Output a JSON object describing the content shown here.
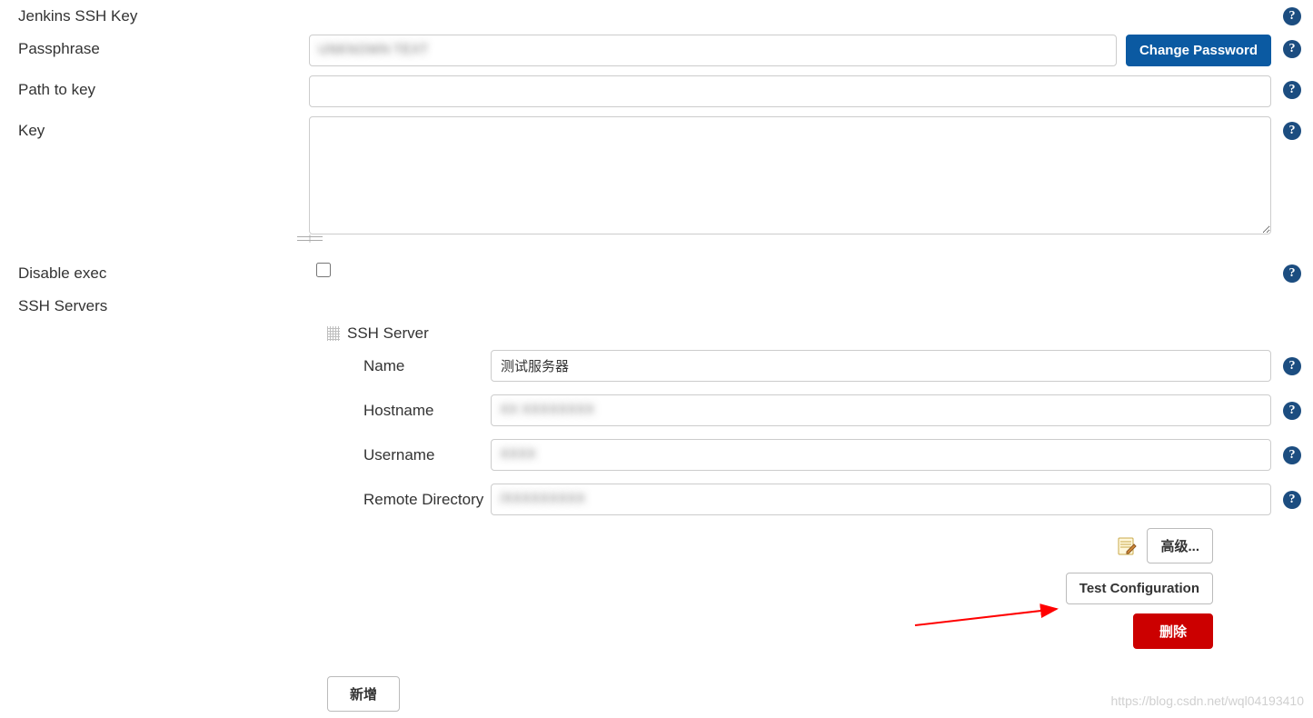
{
  "section_title": "Jenkins SSH Key",
  "labels": {
    "passphrase": "Passphrase",
    "path_to_key": "Path to key",
    "key": "Key",
    "disable_exec": "Disable exec",
    "ssh_servers": "SSH Servers"
  },
  "buttons": {
    "change_password": "Change Password",
    "advanced": "高级...",
    "test_config": "Test Configuration",
    "delete": "删除",
    "add": "新增"
  },
  "ssh_server": {
    "header": "SSH Server",
    "name_label": "Name",
    "name_value": "测试服务器",
    "hostname_label": "Hostname",
    "hostname_value": "",
    "username_label": "Username",
    "username_value": "",
    "remote_dir_label": "Remote Directory",
    "remote_dir_value": ""
  },
  "values": {
    "passphrase": "",
    "path_to_key": "",
    "key": "",
    "disable_exec_checked": false
  },
  "watermark": "https://blog.csdn.net/wql04193410",
  "help_glyph": "?"
}
